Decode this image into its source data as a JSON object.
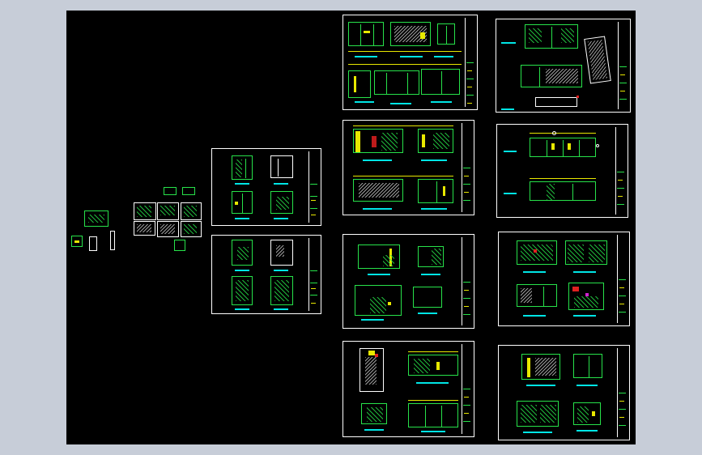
{
  "viewport": {
    "background": "#000000",
    "frame_color": "#c7cdd8",
    "line_colors": {
      "green": "#27e24a",
      "yellow": "#e8e800",
      "cyan": "#00e5e5",
      "white": "#ffffff",
      "red": "#e02020",
      "magenta": "#d020d0"
    }
  },
  "sheets": [
    {
      "id": "sheet-1"
    },
    {
      "id": "sheet-2"
    },
    {
      "id": "sheet-3"
    },
    {
      "id": "sheet-4"
    },
    {
      "id": "sheet-5"
    },
    {
      "id": "sheet-6"
    },
    {
      "id": "sheet-7"
    },
    {
      "id": "sheet-8"
    },
    {
      "id": "sheet-9"
    },
    {
      "id": "sheet-10"
    },
    {
      "id": "sheet-11"
    },
    {
      "id": "sheet-12"
    }
  ]
}
